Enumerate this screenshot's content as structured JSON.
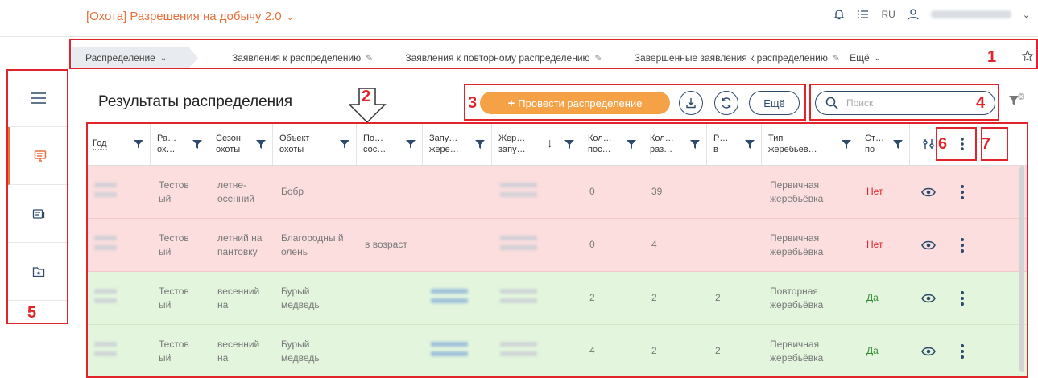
{
  "app": {
    "title": "[Охота] Разрешения на добычу 2.0",
    "lang": "RU"
  },
  "tabs": [
    {
      "label": "Распределение"
    },
    {
      "label": "Заявления к распределению"
    },
    {
      "label": "Заявления к повторному распределению"
    },
    {
      "label": "Завершенные заявления к распределению"
    },
    {
      "label": "Ещё"
    }
  ],
  "page": {
    "title": "Результаты распределения",
    "run_button": "Провести распределение",
    "more_button": "Ещё",
    "search_placeholder": "Поиск"
  },
  "annotations": [
    "1",
    "2",
    "3",
    "4",
    "5",
    "6",
    "7"
  ],
  "columns": [
    {
      "label": "Год",
      "l2": ""
    },
    {
      "label": "Ра…",
      "l2": "ох…"
    },
    {
      "label": "Сезон",
      "l2": "охоты"
    },
    {
      "label": "Объект",
      "l2": "охоты"
    },
    {
      "label": "По…",
      "l2": "сос…"
    },
    {
      "label": "Запу…",
      "l2": "жере…"
    },
    {
      "label": "Жер…",
      "l2": "запу…"
    },
    {
      "label": "Кол…",
      "l2": "пос…"
    },
    {
      "label": "Кол…",
      "l2": "раз…"
    },
    {
      "label": "Р…",
      "l2": "в"
    },
    {
      "label": "Тип",
      "l2": "жеребьев…"
    },
    {
      "label": "Ст…",
      "l2": "по"
    }
  ],
  "rows": [
    {
      "status": "red",
      "c2": "Тестов ый",
      "c3": "летне- осенний",
      "c4": "Бобр",
      "c5": "",
      "c8": "0",
      "c9": "39",
      "c10": "",
      "c11": "Первичная жеребьёвка",
      "c12": "Нет"
    },
    {
      "status": "red",
      "c2": "Тестов ый",
      "c3": "летний на пантовку",
      "c4": "Благородны й олень",
      "c5": "в возраст",
      "c8": "0",
      "c9": "4",
      "c10": "",
      "c11": "Первичная жеребьёвка",
      "c12": "Нет"
    },
    {
      "status": "green",
      "c2": "Тестов ый",
      "c3": "весенний на",
      "c4": "Бурый медведь",
      "c5": "",
      "c8": "2",
      "c9": "2",
      "c10": "2",
      "c11": "Повторная жеребьёвка",
      "c12": "Да"
    },
    {
      "status": "green",
      "c2": "Тестов ый",
      "c3": "весенний на",
      "c4": "Бурый медведь",
      "c5": "",
      "c8": "4",
      "c9": "2",
      "c10": "2",
      "c11": "Первичная жеребьёвка",
      "c12": "Да"
    }
  ],
  "colors": {
    "accent": "#e8713c",
    "annotation": "#e0242a",
    "row_red": "#fcdede",
    "row_green": "#e3f6dd"
  }
}
